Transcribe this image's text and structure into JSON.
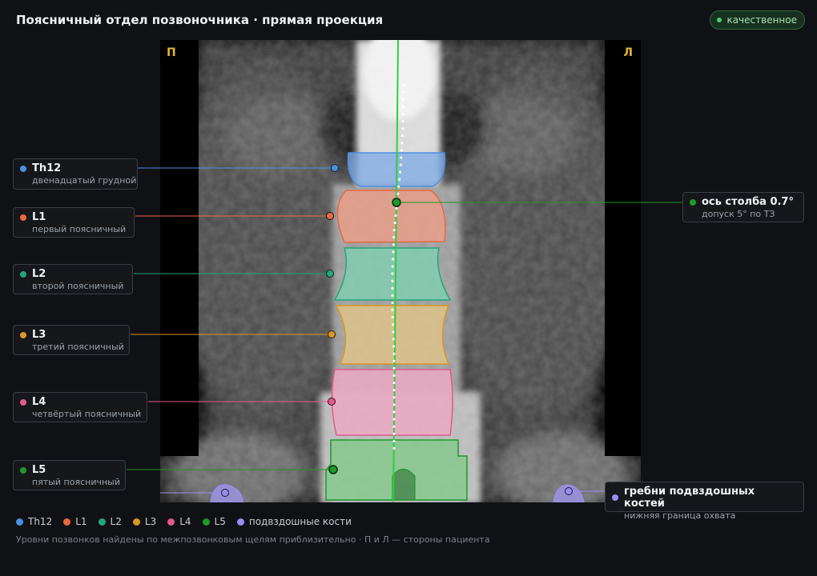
{
  "header": {
    "title": "Поясничный отдел позвоночника · прямая проекция",
    "badge": "качественное"
  },
  "viewer": {
    "side_left": "П",
    "side_right": "Л"
  },
  "labels": {
    "th12": {
      "name": "Th12",
      "sub": "двенадцатый грудной",
      "color": "#4a90e2"
    },
    "l1": {
      "name": "L1",
      "sub": "первый поясничный",
      "color": "#e8693f"
    },
    "l2": {
      "name": "L2",
      "sub": "второй поясничный",
      "color": "#22a57a"
    },
    "l3": {
      "name": "L3",
      "sub": "третий поясничный",
      "color": "#d99820"
    },
    "l4": {
      "name": "L4",
      "sub": "четвёртый поясничный",
      "color": "#e25a8a"
    },
    "l5": {
      "name": "L5",
      "sub": "пятый поясничный",
      "color": "#1d9a2a"
    },
    "axis": {
      "name": "ось столба 0.7°",
      "sub": "допуск 5° по ТЗ",
      "color": "#1d9a2a"
    },
    "iliac": {
      "name": "гребни подвздошных костей",
      "sub": "нижняя граница охвата",
      "color": "#9b8cf0"
    }
  },
  "legend": [
    {
      "label": "Th12",
      "color": "#4a90e2"
    },
    {
      "label": "L1",
      "color": "#e8693f"
    },
    {
      "label": "L2",
      "color": "#22a57a"
    },
    {
      "label": "L3",
      "color": "#d99820"
    },
    {
      "label": "L4",
      "color": "#e25a8a"
    },
    {
      "label": "L5",
      "color": "#1d9a2a"
    },
    {
      "label": "подвздошные кости",
      "color": "#9b8cf0"
    }
  ],
  "footnote": "Уровни позвонков найдены по межпозвонковым щелям приблизительно · П и Л — стороны пациента"
}
